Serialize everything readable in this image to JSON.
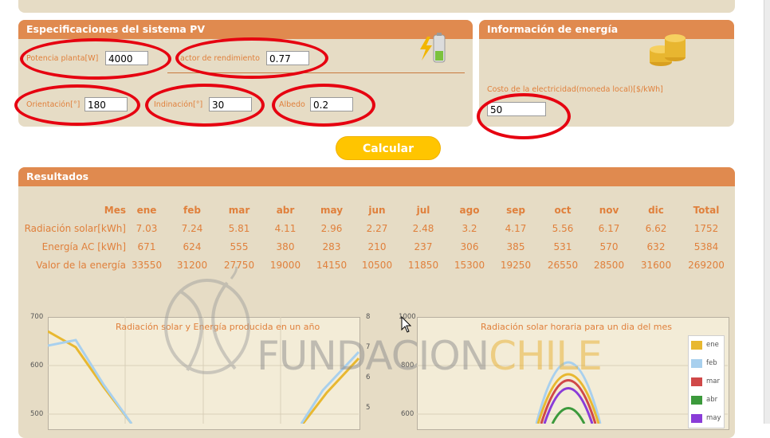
{
  "pv": {
    "title": "Especificaciones del sistema PV",
    "potencia_label": "Potencia planta[W]",
    "potencia_value": "4000",
    "rendimiento_label": "actor de rendimiento",
    "rendimiento_value": "0.77",
    "orientacion_label": "Orientación[°]",
    "orientacion_value": "180",
    "inclinacion_label": "Indinación[°]",
    "inclinacion_value": "30",
    "albedo_label": "Albedo",
    "albedo_value": "0.2",
    "battery_icon": "battery-charging-icon"
  },
  "energia": {
    "title": "Información de energía",
    "costo_label": "Costo de la electricidad(moneda local)[$/kWh]",
    "costo_value": "50",
    "coins_icon": "coins-icon"
  },
  "calcular_label": "Calcular",
  "resultados": {
    "title": "Resultados",
    "headers": [
      "Mes",
      "ene",
      "feb",
      "mar",
      "abr",
      "may",
      "jun",
      "jul",
      "ago",
      "sep",
      "oct",
      "nov",
      "dic",
      "Total"
    ],
    "rows": [
      [
        "Radiación solar[kWh]",
        "7.03",
        "7.24",
        "5.81",
        "4.11",
        "2.96",
        "2.27",
        "2.48",
        "3.2",
        "4.17",
        "5.56",
        "6.17",
        "6.62",
        "1752"
      ],
      [
        "Energía AC [kWh]",
        "671",
        "624",
        "555",
        "380",
        "283",
        "210",
        "237",
        "306",
        "385",
        "531",
        "570",
        "632",
        "5384"
      ],
      [
        "Valor de la energía",
        "33550",
        "31200",
        "27750",
        "19000",
        "14150",
        "10500",
        "11850",
        "15300",
        "19250",
        "26550",
        "28500",
        "31600",
        "269200"
      ]
    ]
  },
  "watermark": {
    "part1": "FUNDACION",
    "part2": "CHILE"
  },
  "colors": {
    "accent": "#e08a4f",
    "panel": "#e6dcc5",
    "label": "#e0803c",
    "button": "#ffc500",
    "annotation": "#e60010"
  },
  "chart_data": [
    {
      "type": "line",
      "title": "Radiación solar y Energía producida en un año",
      "y_ticks_left": [
        "700",
        "600",
        "500"
      ],
      "y_ticks_right": [
        "8",
        "7",
        "6",
        "5"
      ],
      "series": []
    },
    {
      "type": "line",
      "title": "Radiación solar horaria para un dia del mes",
      "y_ticks": [
        "1000",
        "800",
        "600"
      ],
      "legend": [
        "ene",
        "feb",
        "mar",
        "abr",
        "may"
      ],
      "legend_colors": [
        "#e8b830",
        "#a8d0ee",
        "#d04848",
        "#3c9a3c",
        "#8a3cd8"
      ],
      "series": []
    }
  ]
}
